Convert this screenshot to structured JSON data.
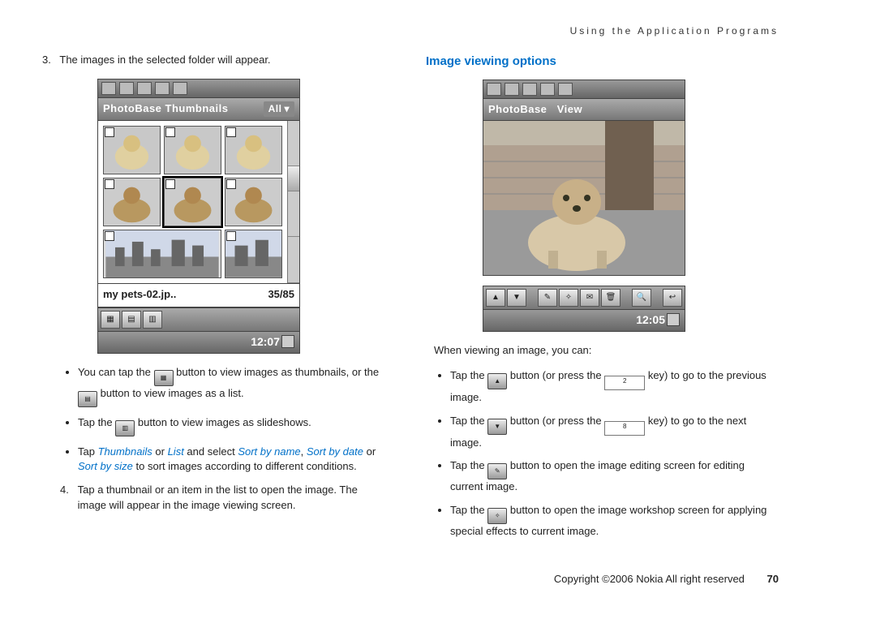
{
  "running_header": "Using the Application Programs",
  "left": {
    "step3_num": "3.",
    "step3_text": "The images in the selected folder will appear.",
    "shot": {
      "appbar_title": "PhotoBase Thumbnails",
      "appbar_drop": "All",
      "filename": "my pets-02.jp..",
      "counter": "35/85",
      "clock": "12:07"
    },
    "bullet1a": "You can tap the ",
    "bullet1b": " button to view images as thumbnails, or the ",
    "bullet1c": " button to view images as a list.",
    "bullet2a": "Tap the ",
    "bullet2b": " button to view images as slideshows.",
    "bullet3a": "Tap ",
    "bullet3_thumb": "Thumbnails",
    "bullet3_or": " or ",
    "bullet3_list": "List",
    "bullet3_sel": " and select ",
    "bullet3_sortname": "Sort by name",
    "bullet3_comma": ", ",
    "bullet3_sortdate": "Sort by date",
    "bullet3_or2": " or ",
    "bullet3_sortsize": "Sort by size",
    "bullet3_tail": " to sort images according to different conditions.",
    "step4_num": "4.",
    "step4_text": "Tap a thumbnail or an item in the list to open the image. The image will appear in the image viewing screen."
  },
  "right": {
    "heading": "Image viewing options",
    "shot": {
      "appbar_title": "PhotoBase",
      "appbar_mode": "View",
      "clock": "12:05"
    },
    "intro": "When viewing an image, you can:",
    "b1a": "Tap the ",
    "b1b": " button (or press the ",
    "b1_key": "2",
    "b1c": " key) to go to the previous image.",
    "b2a": "Tap the ",
    "b2b": " button (or press the ",
    "b2_key": "8",
    "b2c": " key) to go to the next image.",
    "b3a": "Tap the ",
    "b3b": " button to open the image editing screen for editing current image.",
    "b4a": "Tap the ",
    "b4b": " button to open the image workshop screen for applying special effects to current image."
  },
  "footer": {
    "copyright": "Copyright ©2006 Nokia All right reserved",
    "page": "70"
  }
}
